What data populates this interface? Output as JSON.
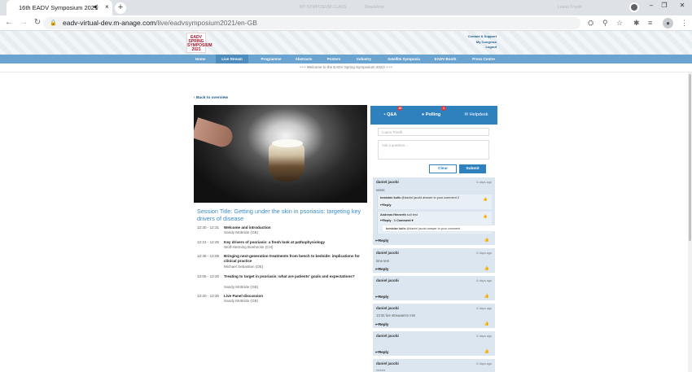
{
  "browser": {
    "tab_title": "16th EADV Symposium 2021",
    "tab_audio_icon": "speaker-icon",
    "new_tab_label": "+",
    "faded_titles": [
      "MY SYMPOSIUM CLAUS",
      "Roadshow",
      "Luana Trivelli"
    ],
    "url_host": "eadv-virtual-dev.m-anage.com",
    "url_path": "/live/eadvsymposium2021/en-GB"
  },
  "site": {
    "logo_text": "EADV SPRING SYMPOSIUM 2021",
    "top_links": [
      "Contact & Support",
      "My Congress",
      "Logout"
    ],
    "nav": [
      "Home",
      "Live Stream",
      "Programme",
      "Abstracts",
      "Posters",
      "Industry",
      "Satellite Symposia",
      "EADV Booth",
      "Press Centre"
    ],
    "active_nav": "Live Stream",
    "welcome": "+++ Welcome to the EADV Spring Symposium 2021! +++"
  },
  "main": {
    "back_label": "Back to overview",
    "session_title": "Session Title: Getting under the skin in psoriasis: targeting key drivers of disease",
    "schedule": [
      {
        "time": "12:30 - 12:31",
        "title": "Welcome and introduction",
        "speaker": "Sandy McBride (GB)"
      },
      {
        "time": "12:31 - 12:45",
        "title": "Key drivers of psoriasis: a fresh look at pathophysiology",
        "speaker": "Wolf-Henning Boehncke (CH)"
      },
      {
        "time": "12:45 - 13:05",
        "title": "Bringing next-generation treatments from bench to bedside: implications for clinical practice",
        "speaker": "Michael Sebastian (DE)"
      },
      {
        "time": "13:05 - 13:20",
        "title": "Treating to target in psoriasis: what are patients' goals and expectations?",
        "speaker": "Sandy McBride (GB)"
      },
      {
        "time": "13:20 - 13:30",
        "title": "Live Panel discussion",
        "speaker": "Sandy McBride (GB)"
      }
    ]
  },
  "panel": {
    "tabs": [
      {
        "label": "Q&A",
        "icon": "chat-icon",
        "badge": "10"
      },
      {
        "label": "Polling",
        "icon": "users-icon",
        "badge": "1"
      },
      {
        "label": "Helpdesk",
        "icon": "envelope-icon",
        "badge": ""
      }
    ],
    "name_value": "Luana Trivelli",
    "question_placeholder": "Ask a question...",
    "clear_label": "Clear",
    "submit_label": "Submit",
    "reply_label": "Reply",
    "comments": [
      {
        "author": "daniel jacobi",
        "ago": "6 days ago",
        "text": "sssss",
        "sub1": {
          "author": "tomislav kulis",
          "text": " @daniel jacobi answer to your comment 2"
        },
        "sub2": {
          "author": "Andreas Hinnerth",
          "text": " soll test",
          "comments_label": "1 Comment"
        },
        "nested": {
          "author": "tomislav kulis",
          "text": " @daniel jacobi answer to your comment"
        }
      },
      {
        "author": "daniel jacobi",
        "ago": "6 days ago",
        "text": "time test"
      },
      {
        "author": "daniel jacobi",
        "ago": "6 days ago",
        "text": ""
      },
      {
        "author": "daniel jacobi",
        "ago": "6 days ago",
        "text": "13:32 live streaaamm mm"
      },
      {
        "author": "daniel jacobi",
        "ago": "6 days ago",
        "text": ""
      },
      {
        "author": "daniel jacobi",
        "ago": "6 days ago",
        "text": "*******"
      }
    ]
  }
}
